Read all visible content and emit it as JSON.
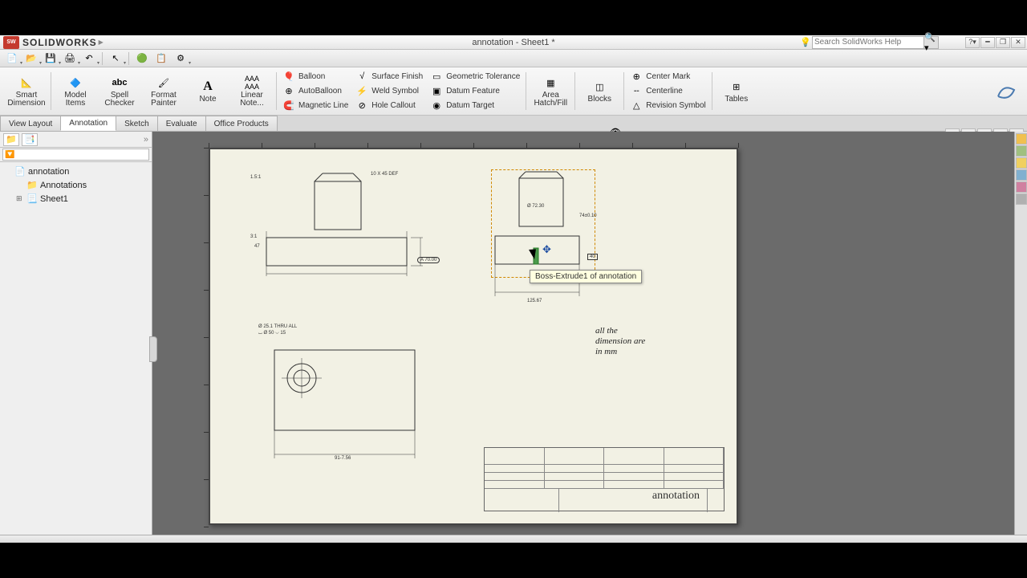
{
  "app": {
    "name": "SOLIDWORKS",
    "docTitle": "annotation - Sheet1 *"
  },
  "search": {
    "placeholder": "Search SolidWorks Help"
  },
  "ribbon": {
    "big": [
      {
        "label": "Smart\nDimension"
      },
      {
        "label": "Model\nItems"
      },
      {
        "label": "Spell\nChecker"
      },
      {
        "label": "Format\nPainter"
      },
      {
        "label": "Note"
      },
      {
        "label": "Linear\nNote..."
      }
    ],
    "col1": [
      {
        "label": "Balloon"
      },
      {
        "label": "AutoBalloon"
      },
      {
        "label": "Magnetic Line"
      }
    ],
    "col2": [
      {
        "label": "Surface Finish"
      },
      {
        "label": "Weld Symbol"
      },
      {
        "label": "Hole Callout"
      }
    ],
    "col3": [
      {
        "label": "Geometric Tolerance"
      },
      {
        "label": "Datum Feature"
      },
      {
        "label": "Datum Target"
      }
    ],
    "big2": [
      {
        "label": "Area\nHatch/Fill"
      },
      {
        "label": "Blocks"
      }
    ],
    "col4": [
      {
        "label": "Center Mark"
      },
      {
        "label": "Centerline"
      },
      {
        "label": "Revision Symbol"
      }
    ],
    "big3": [
      {
        "label": "Tables"
      }
    ]
  },
  "tabs": [
    "View Layout",
    "Annotation",
    "Sketch",
    "Evaluate",
    "Office Products"
  ],
  "tree": {
    "root": "annotation",
    "items": [
      "Annotations",
      "Sheet1"
    ]
  },
  "sheet": {
    "note_text": "all the\ndimension are\nin mm",
    "titleblock_name": "annotation",
    "tooltip": "Boss-Extrude1 of annotation",
    "dims": {
      "d1": "1.5:1",
      "d2": "10 X 45 DEF",
      "d3": "3:1",
      "d4": "47",
      "d5": "A 70.00",
      "d6": "Ø 72.30",
      "d7": "74±0.10",
      "d8": "40",
      "d9": "125.67",
      "d10": "Ø 25.1 THRU ALL",
      "d11": "⌴ Ø 50 ⌵ 15",
      "d12": "91-7.56"
    }
  }
}
